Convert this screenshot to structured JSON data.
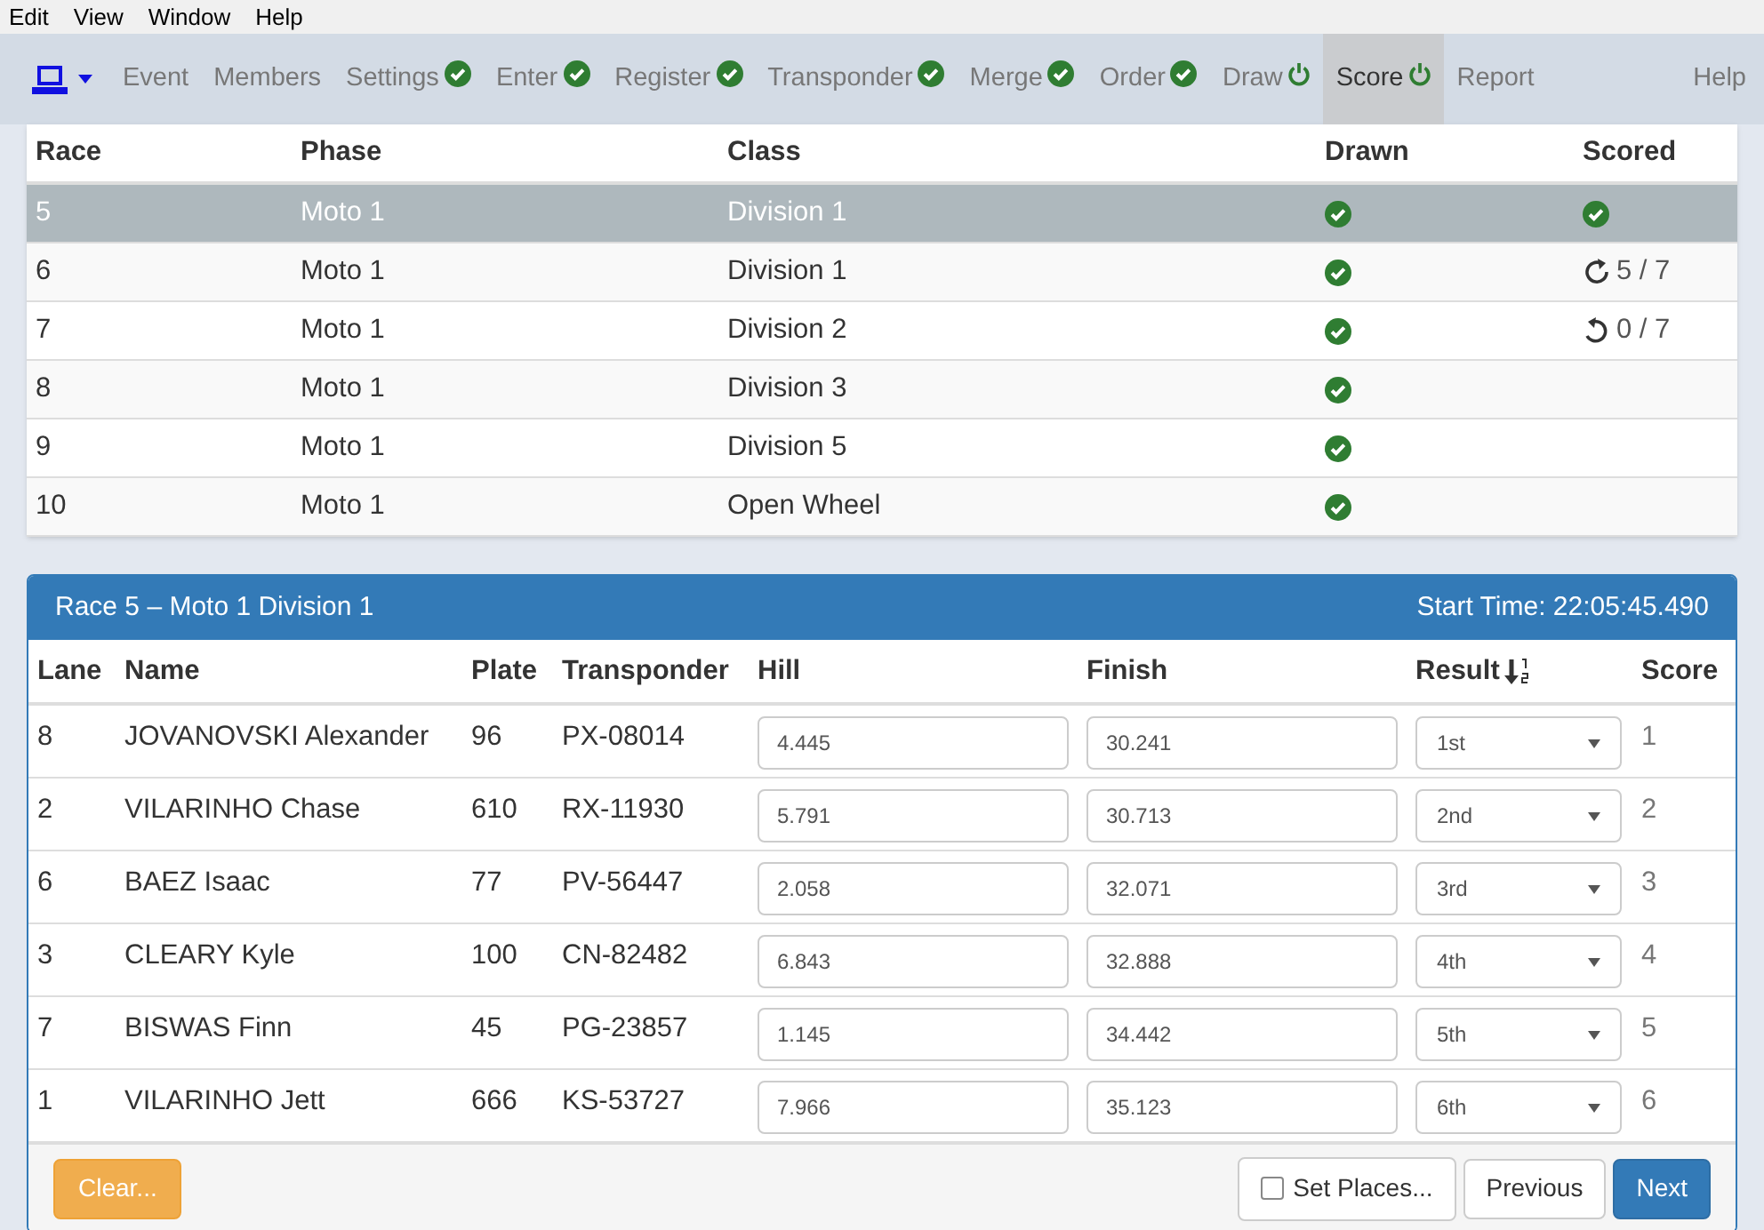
{
  "menu": [
    "Edit",
    "View",
    "Window",
    "Help"
  ],
  "nav": [
    {
      "label": "Event",
      "kind": "plain",
      "selected": false
    },
    {
      "label": "Members",
      "kind": "plain",
      "selected": false
    },
    {
      "label": "Settings",
      "kind": "done",
      "selected": false
    },
    {
      "label": "Enter",
      "kind": "done",
      "selected": false
    },
    {
      "label": "Register",
      "kind": "done",
      "selected": false
    },
    {
      "label": "Transponder",
      "kind": "done",
      "selected": false
    },
    {
      "label": "Merge",
      "kind": "done",
      "selected": false
    },
    {
      "label": "Order",
      "kind": "done",
      "selected": false
    },
    {
      "label": "Draw",
      "kind": "ready",
      "selected": false
    },
    {
      "label": "Score",
      "kind": "ready",
      "selected": true
    },
    {
      "label": "Report",
      "kind": "plain",
      "selected": false
    }
  ],
  "nav_help": "Help",
  "races": {
    "columns": [
      "Race",
      "Phase",
      "Class",
      "Drawn",
      "Scored"
    ],
    "rows": [
      {
        "race": "5",
        "phase": "Moto 1",
        "class": "Division 1",
        "drawn": true,
        "scored": {
          "kind": "done"
        },
        "selected": true
      },
      {
        "race": "6",
        "phase": "Moto 1",
        "class": "Division 1",
        "drawn": true,
        "scored": {
          "kind": "partial",
          "text": "5 / 7"
        },
        "selected": false
      },
      {
        "race": "7",
        "phase": "Moto 1",
        "class": "Division 2",
        "drawn": true,
        "scored": {
          "kind": "pending",
          "text": "0 / 7"
        },
        "selected": false
      },
      {
        "race": "8",
        "phase": "Moto 1",
        "class": "Division 3",
        "drawn": true,
        "scored": {
          "kind": "none"
        },
        "selected": false
      },
      {
        "race": "9",
        "phase": "Moto 1",
        "class": "Division 5",
        "drawn": true,
        "scored": {
          "kind": "none"
        },
        "selected": false
      },
      {
        "race": "10",
        "phase": "Moto 1",
        "class": "Open Wheel",
        "drawn": true,
        "scored": {
          "kind": "none"
        },
        "selected": false
      }
    ]
  },
  "panel": {
    "title": "Race 5 – Moto 1 Division 1",
    "start_time": "Start Time: 22:05:45.490",
    "columns": [
      "Lane",
      "Name",
      "Plate",
      "Transponder",
      "Hill",
      "Finish",
      "Result",
      "Score"
    ],
    "rows": [
      {
        "lane": "8",
        "name": "JOVANOVSKI Alexander",
        "plate": "96",
        "transponder": "PX-08014",
        "hill": "4.445",
        "finish": "30.241",
        "result": "1st",
        "score": "1"
      },
      {
        "lane": "2",
        "name": "VILARINHO Chase",
        "plate": "610",
        "transponder": "RX-11930",
        "hill": "5.791",
        "finish": "30.713",
        "result": "2nd",
        "score": "2"
      },
      {
        "lane": "6",
        "name": "BAEZ Isaac",
        "plate": "77",
        "transponder": "PV-56447",
        "hill": "2.058",
        "finish": "32.071",
        "result": "3rd",
        "score": "3"
      },
      {
        "lane": "3",
        "name": "CLEARY Kyle",
        "plate": "100",
        "transponder": "CN-82482",
        "hill": "6.843",
        "finish": "32.888",
        "result": "4th",
        "score": "4"
      },
      {
        "lane": "7",
        "name": "BISWAS Finn",
        "plate": "45",
        "transponder": "PG-23857",
        "hill": "1.145",
        "finish": "34.442",
        "result": "5th",
        "score": "5"
      },
      {
        "lane": "1",
        "name": "VILARINHO Jett",
        "plate": "666",
        "transponder": "KS-53727",
        "hill": "7.966",
        "finish": "35.123",
        "result": "6th",
        "score": "6"
      }
    ],
    "clear_button": "Clear...",
    "set_places": {
      "label": "Set Places...",
      "checked": false
    },
    "previous_button": "Previous",
    "next_button": "Next"
  }
}
